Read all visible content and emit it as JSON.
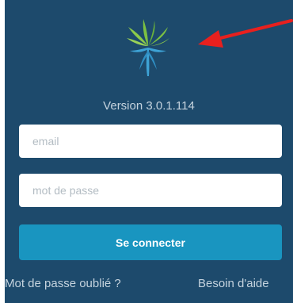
{
  "colors": {
    "background": "#1d4a6c",
    "button": "#1995c0",
    "accent_arrow": "#e8201e",
    "logo_green": "#7cc142",
    "logo_blue": "#3ea3d6"
  },
  "logo": {
    "icon": "palm-tree-logo-icon"
  },
  "annotation": {
    "icon": "red-arrow-icon"
  },
  "version": {
    "text": "Version 3.0.1.114"
  },
  "form": {
    "email_placeholder": "email",
    "email_value": "",
    "password_placeholder": "mot de passe",
    "password_value": "",
    "submit_label": "Se connecter"
  },
  "links": {
    "forgot_password": "Mot de passe oublié ?",
    "help": "Besoin d'aide"
  }
}
